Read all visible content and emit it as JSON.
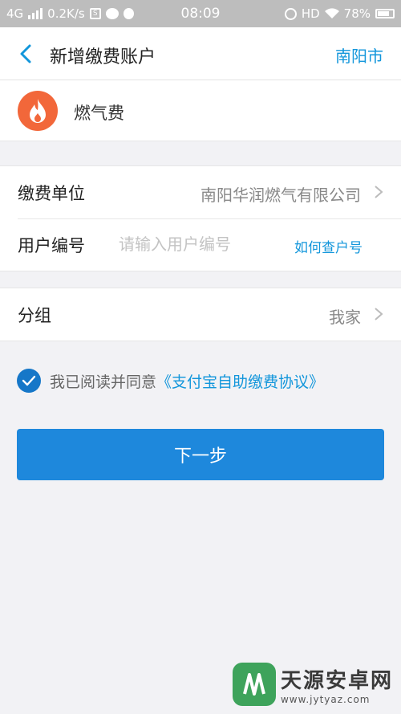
{
  "status_bar": {
    "network": "4G",
    "speed": "0.2K/s",
    "time": "08:09",
    "hd": "HD",
    "battery": "78%"
  },
  "nav": {
    "title": "新增缴费账户",
    "city": "南阳市"
  },
  "biz": {
    "name": "燃气费",
    "icon": "flame-icon",
    "icon_color": "#f2673a"
  },
  "form": {
    "unit_label": "缴费单位",
    "unit_value": "南阳华润燃气有限公司",
    "user_no_label": "用户编号",
    "user_no_placeholder": "请输入用户编号",
    "user_no_value": "",
    "help_link": "如何查户号",
    "group_label": "分组",
    "group_value": "我家"
  },
  "agreement": {
    "checked": true,
    "text": "我已阅读并同意",
    "link": "《支付宝自助缴费协议》"
  },
  "next_button": "下一步",
  "watermark": {
    "name": "天源安卓网",
    "url": "www.jytyaz.com"
  },
  "colors": {
    "accent": "#1296db",
    "button": "#1e88dc",
    "check": "#1677c8"
  }
}
